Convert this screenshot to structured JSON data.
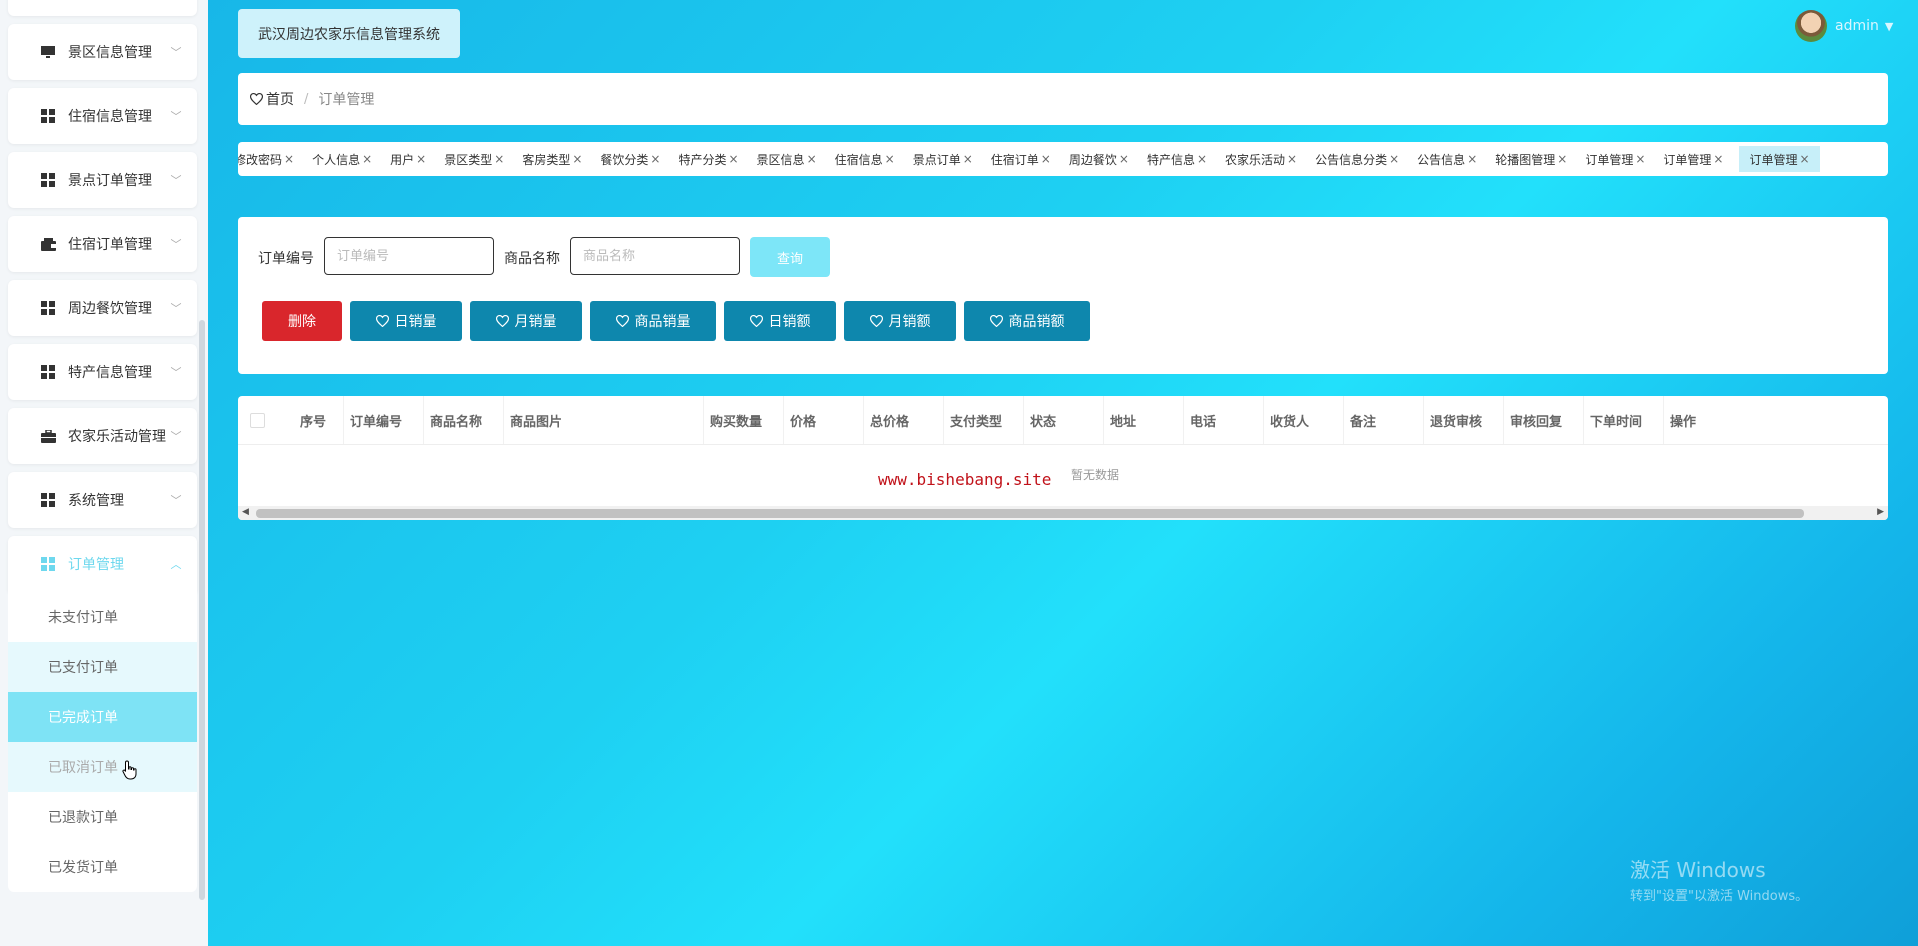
{
  "app": {
    "title": "武汉周边农家乐信息管理系统"
  },
  "user": {
    "name": "admin"
  },
  "sidebar": {
    "items": [
      {
        "label": "景区信息管理",
        "icon": "monitor-icon"
      },
      {
        "label": "住宿信息管理",
        "icon": "grid-icon"
      },
      {
        "label": "景点订单管理",
        "icon": "grid-icon"
      },
      {
        "label": "住宿订单管理",
        "icon": "wallet-icon"
      },
      {
        "label": "周边餐饮管理",
        "icon": "grid-icon"
      },
      {
        "label": "特产信息管理",
        "icon": "grid-icon"
      },
      {
        "label": "农家乐活动管理",
        "icon": "briefcase-icon"
      },
      {
        "label": "系统管理",
        "icon": "grid-icon"
      },
      {
        "label": "订单管理",
        "icon": "grid-icon"
      }
    ],
    "subitems": [
      "未支付订单",
      "已支付订单",
      "已完成订单",
      "已取消订单",
      "已退款订单",
      "已发货订单"
    ]
  },
  "breadcrumb": {
    "home": "首页",
    "separator": "/",
    "current": "订单管理"
  },
  "tags": [
    "修改密码",
    "个人信息",
    "用户",
    "景区类型",
    "客房类型",
    "餐饮分类",
    "特产分类",
    "景区信息",
    "住宿信息",
    "景点订单",
    "住宿订单",
    "周边餐饮",
    "特产信息",
    "农家乐活动",
    "公告信息分类",
    "公告信息",
    "轮播图管理",
    "订单管理",
    "订单管理",
    "订单管理"
  ],
  "search": {
    "order_no_label": "订单编号",
    "order_no_placeholder": "订单编号",
    "product_label": "商品名称",
    "product_placeholder": "商品名称",
    "query_label": "查询"
  },
  "actions": {
    "delete": "删除",
    "daily_sales": "日销量",
    "monthly_sales": "月销量",
    "product_sales": "商品销量",
    "daily_revenue": "日销额",
    "monthly_revenue": "月销额",
    "product_revenue": "商品销额"
  },
  "table": {
    "columns": [
      "序号",
      "订单编号",
      "商品名称",
      "商品图片",
      "购买数量",
      "价格",
      "总价格",
      "支付类型",
      "状态",
      "地址",
      "电话",
      "收货人",
      "备注",
      "退货审核",
      "审核回复",
      "下单时间",
      "操作"
    ],
    "empty_text": "暂无数据",
    "watermark": "www.bishebang.site"
  },
  "windows_watermark": {
    "line1": "激活 Windows",
    "line2": "转到\"设置\"以激活 Windows。"
  },
  "colors": {
    "accent": "#7ee3f5",
    "danger": "#d9262c",
    "primary_button": "#0e87ad"
  }
}
